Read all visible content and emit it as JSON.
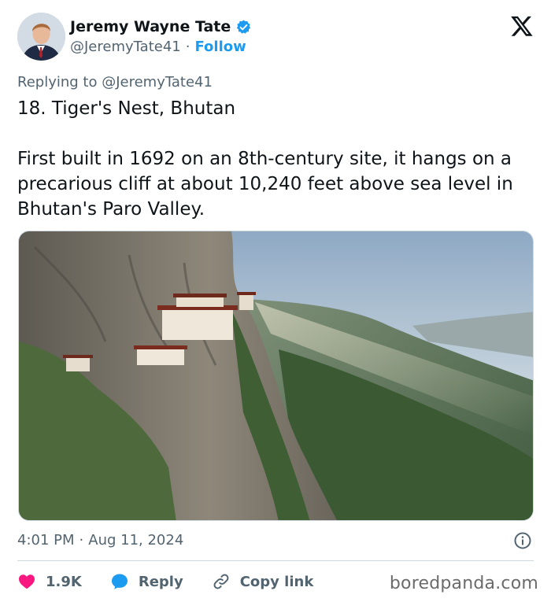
{
  "author": {
    "display_name": "Jeremy Wayne Tate",
    "handle": "@JeremyTate41",
    "separator": "·",
    "follow_label": "Follow"
  },
  "post": {
    "replying_prefix": "Replying to",
    "replying_to": "@JeremyTate41",
    "title": "18. Tiger's Nest, Bhutan",
    "body": "First built in 1692 on an 8th-century site, it hangs on a precarious cliff at about 10,240 feet above sea level in Bhutan's Paro Valley.",
    "time": "4:01 PM",
    "separator": "·",
    "date": "Aug 11, 2024"
  },
  "actions": {
    "like_count": "1.9K",
    "reply_label": "Reply",
    "copy_label": "Copy link"
  },
  "watermark": "boredpanda.com",
  "icons": {
    "verified": "verified-badge-icon",
    "x_logo": "x-logo-icon",
    "info": "info-icon",
    "like": "heart-icon",
    "reply": "speech-bubble-icon",
    "copy": "link-icon"
  },
  "colors": {
    "accent": "#1d9bf0",
    "like": "#f91880",
    "muted_text": "#536471"
  }
}
